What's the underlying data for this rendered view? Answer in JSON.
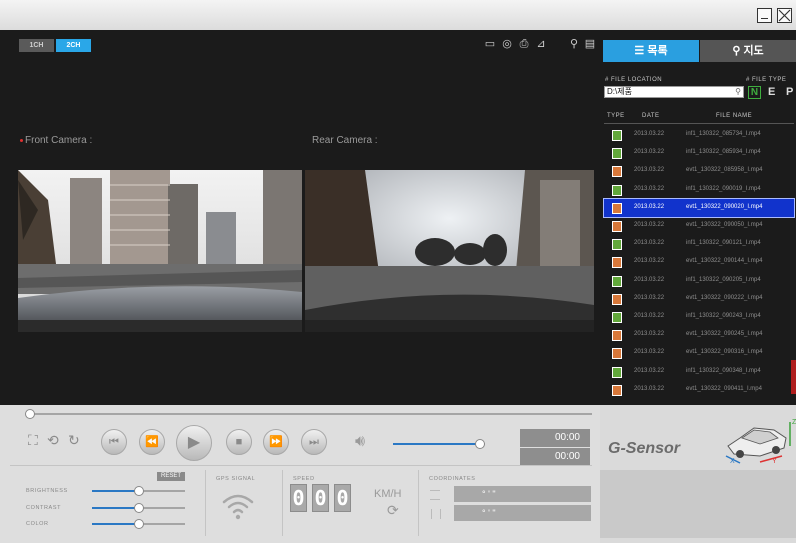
{
  "window": {
    "minimize_icon": "minimize-icon",
    "close_icon": "close-icon"
  },
  "channels": {
    "ch1": "1CH",
    "ch2": "2CH"
  },
  "toolbar_icons": [
    "monitor-icon",
    "settings-icon",
    "print-icon",
    "chart-icon",
    "search-icon",
    "document-icon"
  ],
  "cameras": {
    "front": "Front Camera :",
    "rear": "Rear Camera :"
  },
  "tabs": {
    "list": "목록",
    "map": "지도"
  },
  "file_location": {
    "label": "# FILE LOCATION",
    "value": "D:\\제품",
    "search_icon": "search-icon"
  },
  "file_type": {
    "label": "# FILE TYPE",
    "types": [
      "N",
      "E",
      "P"
    ]
  },
  "list_headers": {
    "type": "TYPE",
    "date": "DATE",
    "name": "FILE NAME"
  },
  "files": [
    {
      "type": "N",
      "date": "2013.03.22",
      "name": "inf1_130322_085734_I.mp4"
    },
    {
      "type": "N",
      "date": "2013.03.22",
      "name": "inf1_130322_085934_I.mp4"
    },
    {
      "type": "E",
      "date": "2013.03.22",
      "name": "evt1_130322_085958_I.mp4"
    },
    {
      "type": "N",
      "date": "2013.03.22",
      "name": "inf1_130322_090019_I.mp4"
    },
    {
      "type": "E",
      "date": "2013.03.22",
      "name": "evt1_130322_090020_I.mp4",
      "selected": true
    },
    {
      "type": "E",
      "date": "2013.03.22",
      "name": "evt1_130322_090050_I.mp4"
    },
    {
      "type": "N",
      "date": "2013.03.22",
      "name": "inf1_130322_090121_I.mp4"
    },
    {
      "type": "E",
      "date": "2013.03.22",
      "name": "evt1_130322_090144_I.mp4"
    },
    {
      "type": "N",
      "date": "2013.03.22",
      "name": "inf1_130322_090205_I.mp4"
    },
    {
      "type": "E",
      "date": "2013.03.22",
      "name": "evt1_130322_090222_I.mp4"
    },
    {
      "type": "N",
      "date": "2013.03.22",
      "name": "inf1_130322_090243_I.mp4"
    },
    {
      "type": "E",
      "date": "2013.03.22",
      "name": "evt1_130322_090245_I.mp4"
    },
    {
      "type": "E",
      "date": "2013.03.22",
      "name": "evt1_130322_090316_I.mp4"
    },
    {
      "type": "N",
      "date": "2013.03.22",
      "name": "inf1_130322_090348_I.mp4"
    },
    {
      "type": "E",
      "date": "2013.03.22",
      "name": "evt1_130322_090411_I.mp4"
    }
  ],
  "playback": {
    "progress": 0.0,
    "current_time": "00:00",
    "total_time": "00:00",
    "volume": 0.95
  },
  "adjust": {
    "reset": "RESET",
    "brightness": {
      "label": "BRIGHTNESS",
      "value": 0.5
    },
    "contrast": {
      "label": "CONTRAST",
      "value": 0.5
    },
    "color": {
      "label": "COLOR",
      "value": 0.5
    }
  },
  "gps": {
    "label": "GPS SIGNAL"
  },
  "speed": {
    "label": "SPEED",
    "digits": [
      "0",
      "0",
      "0"
    ],
    "unit": "KM/H"
  },
  "coordinates": {
    "label": "COORDINATES",
    "lat": "°   '   \"",
    "lon": "°   '   \""
  },
  "gsensor": {
    "title": "G-Sensor",
    "axes": [
      "X",
      "Y",
      "Z"
    ]
  },
  "colors": {
    "accent": "#2a78c4",
    "selected_row": "#1133cc",
    "tab_active": "#2a9fe0",
    "normal_file": "#62a83b",
    "event_file": "#d8783a"
  }
}
